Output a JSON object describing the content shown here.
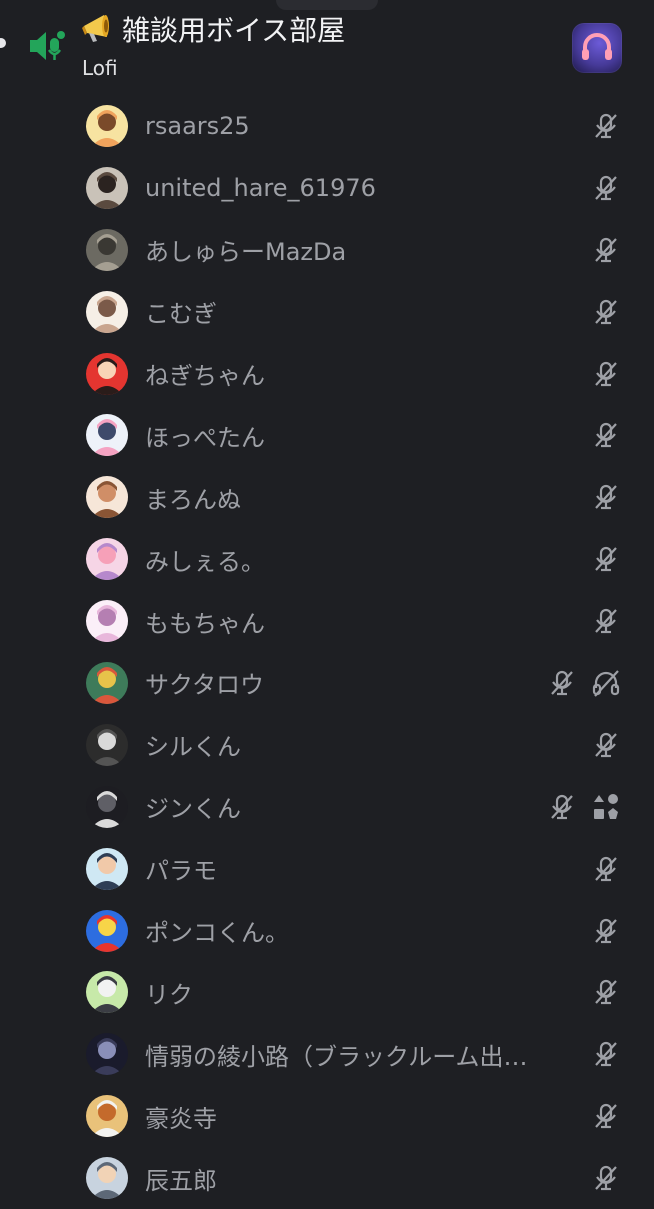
{
  "channel": {
    "title": "雑談用ボイス部屋",
    "status": "Lofi"
  },
  "colors": {
    "background": "#1e1f23",
    "name_text": "#9ea0a6",
    "voice_green": "#23a55a",
    "icon_gray": "#9ea0a6"
  },
  "members": [
    {
      "name": "rsaars25",
      "avatar": "avatar-cartoon-duo",
      "icons": [
        "mic-muted-icon"
      ]
    },
    {
      "name": "united_hare_61976",
      "avatar": "avatar-headscarf",
      "icons": [
        "mic-muted-icon"
      ]
    },
    {
      "name": "あしゅらーMazDa",
      "avatar": "avatar-photo-desk",
      "icons": [
        "mic-muted-icon"
      ]
    },
    {
      "name": "こむぎ",
      "avatar": "avatar-girl-cat",
      "icons": [
        "mic-muted-icon"
      ]
    },
    {
      "name": "ねぎちゃん",
      "avatar": "avatar-red-boy",
      "icons": [
        "mic-muted-icon"
      ]
    },
    {
      "name": "ほっぺたん",
      "avatar": "avatar-white-mascot",
      "icons": [
        "mic-muted-icon"
      ]
    },
    {
      "name": "まろんぬ",
      "avatar": "avatar-brown-hair-girl",
      "icons": [
        "mic-muted-icon"
      ]
    },
    {
      "name": "みしぇる。",
      "avatar": "avatar-pink-anime",
      "icons": [
        "mic-muted-icon"
      ]
    },
    {
      "name": "ももちゃん",
      "avatar": "avatar-pink-bunny",
      "icons": [
        "mic-muted-icon"
      ]
    },
    {
      "name": "サクタロウ",
      "avatar": "avatar-colorful-illustration",
      "icons": [
        "mic-muted-icon",
        "headphones-deafened-icon"
      ]
    },
    {
      "name": "シルくん",
      "avatar": "avatar-masked-man",
      "icons": [
        "mic-muted-icon"
      ]
    },
    {
      "name": "ジンくん",
      "avatar": "avatar-dark-character",
      "icons": [
        "mic-muted-icon",
        "activity-icon"
      ]
    },
    {
      "name": "パラモ",
      "avatar": "avatar-smiling-boy",
      "icons": [
        "mic-muted-icon"
      ]
    },
    {
      "name": "ポンコくん。",
      "avatar": "avatar-blue-red-character",
      "icons": [
        "mic-muted-icon"
      ]
    },
    {
      "name": "リク",
      "avatar": "avatar-penguin",
      "icons": [
        "mic-muted-icon"
      ]
    },
    {
      "name": "情弱の綾小路（ブラックルーム出…",
      "avatar": "avatar-dark-anime",
      "icons": [
        "mic-muted-icon"
      ]
    },
    {
      "name": "豪炎寺",
      "avatar": "avatar-spiky-hair",
      "icons": [
        "mic-muted-icon"
      ]
    },
    {
      "name": "辰五郎",
      "avatar": "avatar-old-man",
      "icons": [
        "mic-muted-icon"
      ]
    }
  ]
}
